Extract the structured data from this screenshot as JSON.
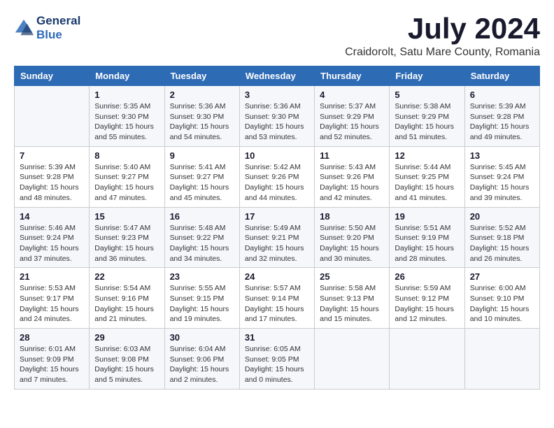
{
  "header": {
    "logo_line1": "General",
    "logo_line2": "Blue",
    "month_year": "July 2024",
    "location": "Craidorolt, Satu Mare County, Romania"
  },
  "weekdays": [
    "Sunday",
    "Monday",
    "Tuesday",
    "Wednesday",
    "Thursday",
    "Friday",
    "Saturday"
  ],
  "weeks": [
    [
      {
        "day": "",
        "info": ""
      },
      {
        "day": "1",
        "info": "Sunrise: 5:35 AM\nSunset: 9:30 PM\nDaylight: 15 hours\nand 55 minutes."
      },
      {
        "day": "2",
        "info": "Sunrise: 5:36 AM\nSunset: 9:30 PM\nDaylight: 15 hours\nand 54 minutes."
      },
      {
        "day": "3",
        "info": "Sunrise: 5:36 AM\nSunset: 9:30 PM\nDaylight: 15 hours\nand 53 minutes."
      },
      {
        "day": "4",
        "info": "Sunrise: 5:37 AM\nSunset: 9:29 PM\nDaylight: 15 hours\nand 52 minutes."
      },
      {
        "day": "5",
        "info": "Sunrise: 5:38 AM\nSunset: 9:29 PM\nDaylight: 15 hours\nand 51 minutes."
      },
      {
        "day": "6",
        "info": "Sunrise: 5:39 AM\nSunset: 9:28 PM\nDaylight: 15 hours\nand 49 minutes."
      }
    ],
    [
      {
        "day": "7",
        "info": "Sunrise: 5:39 AM\nSunset: 9:28 PM\nDaylight: 15 hours\nand 48 minutes."
      },
      {
        "day": "8",
        "info": "Sunrise: 5:40 AM\nSunset: 9:27 PM\nDaylight: 15 hours\nand 47 minutes."
      },
      {
        "day": "9",
        "info": "Sunrise: 5:41 AM\nSunset: 9:27 PM\nDaylight: 15 hours\nand 45 minutes."
      },
      {
        "day": "10",
        "info": "Sunrise: 5:42 AM\nSunset: 9:26 PM\nDaylight: 15 hours\nand 44 minutes."
      },
      {
        "day": "11",
        "info": "Sunrise: 5:43 AM\nSunset: 9:26 PM\nDaylight: 15 hours\nand 42 minutes."
      },
      {
        "day": "12",
        "info": "Sunrise: 5:44 AM\nSunset: 9:25 PM\nDaylight: 15 hours\nand 41 minutes."
      },
      {
        "day": "13",
        "info": "Sunrise: 5:45 AM\nSunset: 9:24 PM\nDaylight: 15 hours\nand 39 minutes."
      }
    ],
    [
      {
        "day": "14",
        "info": "Sunrise: 5:46 AM\nSunset: 9:24 PM\nDaylight: 15 hours\nand 37 minutes."
      },
      {
        "day": "15",
        "info": "Sunrise: 5:47 AM\nSunset: 9:23 PM\nDaylight: 15 hours\nand 36 minutes."
      },
      {
        "day": "16",
        "info": "Sunrise: 5:48 AM\nSunset: 9:22 PM\nDaylight: 15 hours\nand 34 minutes."
      },
      {
        "day": "17",
        "info": "Sunrise: 5:49 AM\nSunset: 9:21 PM\nDaylight: 15 hours\nand 32 minutes."
      },
      {
        "day": "18",
        "info": "Sunrise: 5:50 AM\nSunset: 9:20 PM\nDaylight: 15 hours\nand 30 minutes."
      },
      {
        "day": "19",
        "info": "Sunrise: 5:51 AM\nSunset: 9:19 PM\nDaylight: 15 hours\nand 28 minutes."
      },
      {
        "day": "20",
        "info": "Sunrise: 5:52 AM\nSunset: 9:18 PM\nDaylight: 15 hours\nand 26 minutes."
      }
    ],
    [
      {
        "day": "21",
        "info": "Sunrise: 5:53 AM\nSunset: 9:17 PM\nDaylight: 15 hours\nand 24 minutes."
      },
      {
        "day": "22",
        "info": "Sunrise: 5:54 AM\nSunset: 9:16 PM\nDaylight: 15 hours\nand 21 minutes."
      },
      {
        "day": "23",
        "info": "Sunrise: 5:55 AM\nSunset: 9:15 PM\nDaylight: 15 hours\nand 19 minutes."
      },
      {
        "day": "24",
        "info": "Sunrise: 5:57 AM\nSunset: 9:14 PM\nDaylight: 15 hours\nand 17 minutes."
      },
      {
        "day": "25",
        "info": "Sunrise: 5:58 AM\nSunset: 9:13 PM\nDaylight: 15 hours\nand 15 minutes."
      },
      {
        "day": "26",
        "info": "Sunrise: 5:59 AM\nSunset: 9:12 PM\nDaylight: 15 hours\nand 12 minutes."
      },
      {
        "day": "27",
        "info": "Sunrise: 6:00 AM\nSunset: 9:10 PM\nDaylight: 15 hours\nand 10 minutes."
      }
    ],
    [
      {
        "day": "28",
        "info": "Sunrise: 6:01 AM\nSunset: 9:09 PM\nDaylight: 15 hours\nand 7 minutes."
      },
      {
        "day": "29",
        "info": "Sunrise: 6:03 AM\nSunset: 9:08 PM\nDaylight: 15 hours\nand 5 minutes."
      },
      {
        "day": "30",
        "info": "Sunrise: 6:04 AM\nSunset: 9:06 PM\nDaylight: 15 hours\nand 2 minutes."
      },
      {
        "day": "31",
        "info": "Sunrise: 6:05 AM\nSunset: 9:05 PM\nDaylight: 15 hours\nand 0 minutes."
      },
      {
        "day": "",
        "info": ""
      },
      {
        "day": "",
        "info": ""
      },
      {
        "day": "",
        "info": ""
      }
    ]
  ]
}
